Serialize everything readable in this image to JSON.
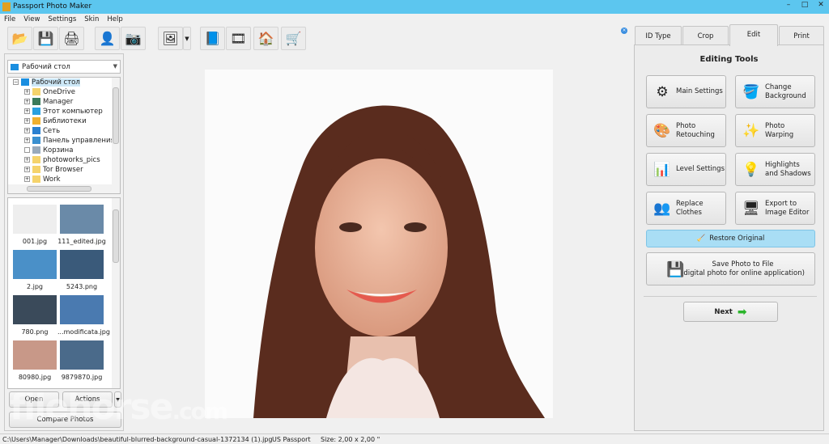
{
  "window": {
    "title": "Passport Photo Maker",
    "controls": [
      "–",
      "□",
      "✕"
    ]
  },
  "menu": [
    "File",
    "View",
    "Settings",
    "Skin",
    "Help"
  ],
  "toolbar": [
    {
      "icon": "open-folder-icon",
      "glyph": "📂"
    },
    {
      "icon": "save-icon",
      "glyph": "💾"
    },
    {
      "icon": "print-icon",
      "glyph": "🖨"
    },
    {
      "icon": "user-search-icon",
      "glyph": "👤"
    },
    {
      "icon": "camera-icon",
      "glyph": "📷"
    },
    {
      "icon": "image-zoom-icon",
      "glyph": "🖼"
    },
    {
      "icon": "help-book-icon",
      "glyph": "📘"
    },
    {
      "icon": "video-reel-icon",
      "glyph": "🎞"
    },
    {
      "icon": "home-icon",
      "glyph": "🏠"
    },
    {
      "icon": "cart-icon",
      "glyph": "🛒"
    }
  ],
  "folder": {
    "selected": "Рабочий стол",
    "tree": [
      "Рабочий стол",
      "OneDrive",
      "Manager",
      "Этот компьютер",
      "Библиотеки",
      "Сеть",
      "Панель управления",
      "Корзина",
      "photoworks_pics",
      "Tor Browser",
      "Work"
    ]
  },
  "thumbnails": [
    "001.jpg",
    "111_edited.jpg",
    "2.jpg",
    "5243.png",
    "780.png",
    "...modificata.jpg",
    "80980.jpg",
    "9879870.jpg"
  ],
  "left_buttons": {
    "open": "Open",
    "actions": "Actions",
    "compare": "Compare Photos"
  },
  "tabs": [
    "ID Type",
    "Crop",
    "Edit",
    "Print"
  ],
  "active_tab": "Edit",
  "edit": {
    "heading": "Editing Tools",
    "tools": [
      {
        "label": "Main Settings",
        "icon": "gear-settings-icon",
        "glyph": "⚙"
      },
      {
        "label": "Change Background",
        "icon": "paint-bucket-icon",
        "glyph": "🪣"
      },
      {
        "label": "Photo Retouching",
        "icon": "palette-icon",
        "glyph": "🎨"
      },
      {
        "label": "Photo Warping",
        "icon": "magic-wand-icon",
        "glyph": "✨"
      },
      {
        "label": "Level Settings",
        "icon": "levels-icon",
        "glyph": "📊"
      },
      {
        "label": "Highlights and Shadows",
        "icon": "lightbulb-icon",
        "glyph": "💡"
      },
      {
        "label": "Replace Clothes",
        "icon": "people-icon",
        "glyph": "👥"
      },
      {
        "label": "Export to Image Editor",
        "icon": "monitor-export-icon",
        "glyph": "🖥"
      }
    ],
    "restore": "Restore Original",
    "save_line1": "Save Photo to File",
    "save_line2": "(digital photo for online application)",
    "next": "Next"
  },
  "status": {
    "path": "C:\\Users\\Manager\\Downloads\\beautiful-blurred-background-casual-1372134 (1).jpg",
    "format": "US Passport",
    "size": "Size: 2,00 x 2,00 \""
  },
  "colors": {
    "titlebar": "#5cc6ef",
    "restore": "#a9def5"
  }
}
